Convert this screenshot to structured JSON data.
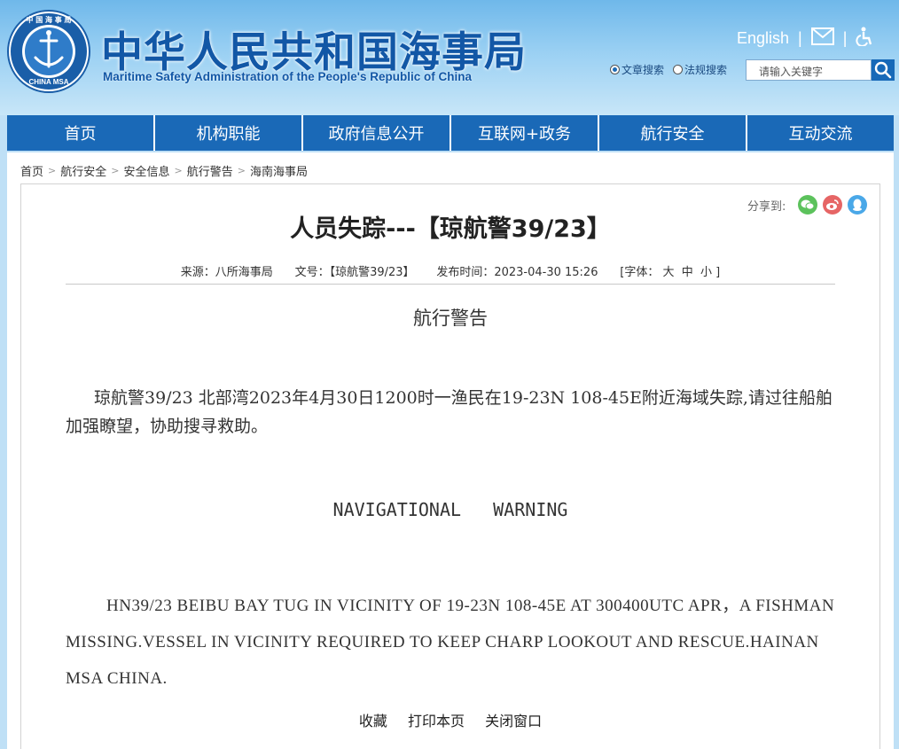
{
  "header": {
    "title": "中华人民共和国海事局",
    "subtitle": "Maritime Safety Administration of the People's Republic of China",
    "logo_text_top": "中 国 海 事 局",
    "logo_text_bottom": "CHINA MSA",
    "english_link": "English",
    "separator": "|",
    "search_options": [
      {
        "label": "文章搜索",
        "selected": true
      },
      {
        "label": "法规搜索",
        "selected": false
      }
    ],
    "search_placeholder": "请输入关键字",
    "colors": {
      "primary": "#1a69b7",
      "title": "#1257a6"
    }
  },
  "nav": {
    "items": [
      "首页",
      "机构职能",
      "政府信息公开",
      "互联网+政务",
      "航行安全",
      "互动交流"
    ]
  },
  "breadcrumb": [
    "首页",
    "航行安全",
    "安全信息",
    "航行警告",
    "海南海事局"
  ],
  "share": {
    "label": "分享到:",
    "icons": [
      "wechat-icon",
      "weibo-icon",
      "qq-icon"
    ]
  },
  "article": {
    "title": "人员失踪---【琼航警39/23】",
    "meta": {
      "source": "来源：八所海事局",
      "doc_no": "文号：【琼航警39/23】",
      "publish_time": "发布时间：2023-04-30 15:26",
      "font_size": "[字体： 大  中  小 ]"
    },
    "heading_cn": "航行警告",
    "paragraph_cn": "琼航警39/23  北部湾2023年4月30日1200时一渔民在19-23N  108-45E附近海域失踪,请过往船舶加强瞭望，协助搜寻救助。",
    "heading_en": "NAVIGATIONAL   WARNING",
    "paragraph_en": "HN39/23   BEIBU BAY TUG  IN VICINITY OF 19-23N 108-45E AT 300400UTC APR，A FISHMAN MISSING.VESSEL IN VICINITY REQUIRED TO KEEP CHARP LOOKOUT AND RESCUE.HAINAN MSA   CHINA.",
    "actions": [
      "收藏",
      "打印本页",
      "关闭窗口"
    ]
  }
}
